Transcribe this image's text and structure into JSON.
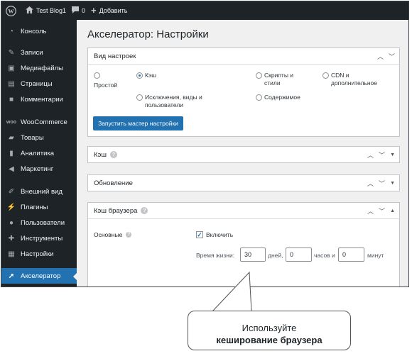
{
  "adminbar": {
    "site_name": "Test Blog1",
    "comments_count": "0",
    "add_new": "Добавить"
  },
  "sidebar": {
    "items": [
      {
        "label": "Консоль",
        "icon": "dashboard-icon"
      },
      {
        "label": "Записи",
        "icon": "pin-icon"
      },
      {
        "label": "Медиафайлы",
        "icon": "media-icon"
      },
      {
        "label": "Страницы",
        "icon": "page-icon"
      },
      {
        "label": "Комментарии",
        "icon": "comment-icon"
      },
      {
        "label": "WooCommerce",
        "icon": "woo-icon"
      },
      {
        "label": "Товары",
        "icon": "archive-icon"
      },
      {
        "label": "Аналитика",
        "icon": "chart-icon"
      },
      {
        "label": "Маркетинг",
        "icon": "megaphone-icon"
      },
      {
        "label": "Внешний вид",
        "icon": "brush-icon"
      },
      {
        "label": "Плагины",
        "icon": "plug-icon"
      },
      {
        "label": "Пользователи",
        "icon": "users-icon"
      },
      {
        "label": "Инструменты",
        "icon": "wrench-icon"
      },
      {
        "label": "Настройки",
        "icon": "settings-icon"
      },
      {
        "label": "Акселератор",
        "icon": "accelerator-icon"
      }
    ],
    "active_index": 14
  },
  "page": {
    "title": "Акселератор: Настройки"
  },
  "settings_view": {
    "title": "Вид настроек",
    "options": [
      "Простой",
      "Кэш",
      "Скрипты и стили",
      "CDN и дополнительное",
      "Исключения, виды и пользователи",
      "Содержимое"
    ],
    "option_lines": {
      "scripts": [
        "Скрипты и",
        "стили"
      ],
      "cdn": [
        "CDN и",
        "дополнительное"
      ],
      "exclusions": [
        "Исключения, виды и",
        "пользователи"
      ]
    },
    "selected": "Кэш",
    "wizard_button": "Запустить мастер настройки"
  },
  "panels": {
    "cache": "Кэш",
    "update": "Обновление",
    "browser_cache": "Кэш браузера"
  },
  "browser_cache": {
    "row_label": "Основные",
    "enable_label": "Включить",
    "enabled": true,
    "lifetime_label": "Время жизни:",
    "days_value": "30",
    "days_label": "дней,",
    "hours_value": "0",
    "hours_label": "часов и",
    "minutes_value": "0",
    "minutes_label": "минут"
  },
  "callout": {
    "line1": "Используйте",
    "line2": "кеширование браузера"
  },
  "colors": {
    "adminbar_bg": "#1d2327",
    "accent": "#2271b1",
    "page_bg": "#f0f0f1"
  }
}
